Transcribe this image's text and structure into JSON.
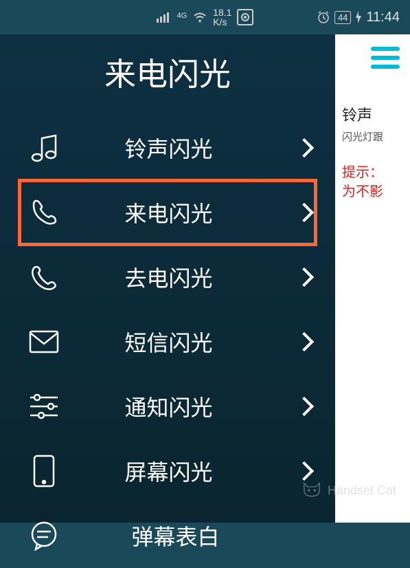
{
  "status_bar": {
    "signal_label": "4G",
    "speed": "18.1\nK/s",
    "battery": "44",
    "time": "11:44"
  },
  "header": {
    "title": "来电闪光"
  },
  "menu": {
    "items": [
      {
        "icon": "music-note-icon",
        "label": "铃声闪光"
      },
      {
        "icon": "phone-receive-icon",
        "label": "来电闪光"
      },
      {
        "icon": "phone-call-icon",
        "label": "去电闪光"
      },
      {
        "icon": "mail-icon",
        "label": "短信闪光"
      },
      {
        "icon": "sliders-icon",
        "label": "通知闪光"
      },
      {
        "icon": "smartphone-icon",
        "label": "屏幕闪光"
      },
      {
        "icon": "message-icon",
        "label": "弹幕表白"
      }
    ],
    "highlighted_index": 1
  },
  "side_panel": {
    "title": "铃声",
    "subtitle": "闪光灯跟",
    "warning_line1": "提示：",
    "warning_line2": "为不影"
  },
  "watermark": {
    "text": "Handset Cat"
  }
}
